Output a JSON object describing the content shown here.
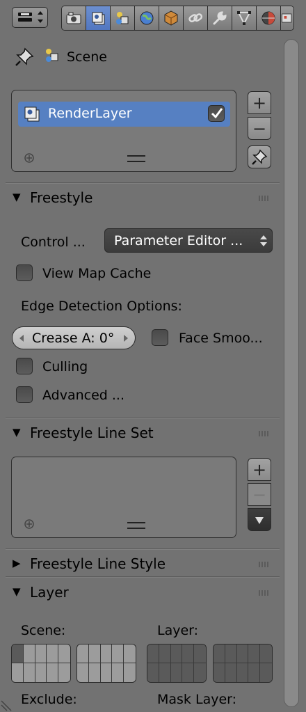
{
  "header": {
    "tabs": [
      {
        "icon": "render-camera-icon",
        "active": false
      },
      {
        "icon": "render-layers-icon",
        "active": true
      },
      {
        "icon": "scene-icon",
        "active": false
      },
      {
        "icon": "world-icon",
        "active": false
      },
      {
        "icon": "object-cube-icon",
        "active": false
      },
      {
        "icon": "constraints-link-icon",
        "active": false
      },
      {
        "icon": "modifiers-wrench-icon",
        "active": false
      },
      {
        "icon": "object-data-vertices-icon",
        "active": false
      },
      {
        "icon": "material-sphere-icon",
        "active": false
      },
      {
        "icon": "texture-icon",
        "active": false
      }
    ]
  },
  "context": {
    "scene_label": "Scene"
  },
  "render_layers": {
    "items": [
      {
        "label": "RenderLayer",
        "enabled": true
      }
    ]
  },
  "freestyle": {
    "title": "Freestyle",
    "control_label": "Control ...",
    "control_value": "Parameter Editor ...",
    "view_map_cache": "View Map Cache",
    "edge_detection_label": "Edge Detection Options:",
    "crease_angle": "Crease A: 0°",
    "face_smoothness": "Face Smoo...",
    "culling": "Culling",
    "advanced": "Advanced ..."
  },
  "line_set": {
    "title": "Freestyle Line Set"
  },
  "line_style": {
    "title": "Freestyle Line Style"
  },
  "layer": {
    "title": "Layer",
    "scene_label": "Scene:",
    "layer_label": "Layer:",
    "exclude_label": "Exclude:",
    "mask_label": "Mask Layer:"
  },
  "colors": {
    "background": "#727272",
    "selection": "#5680c2"
  }
}
